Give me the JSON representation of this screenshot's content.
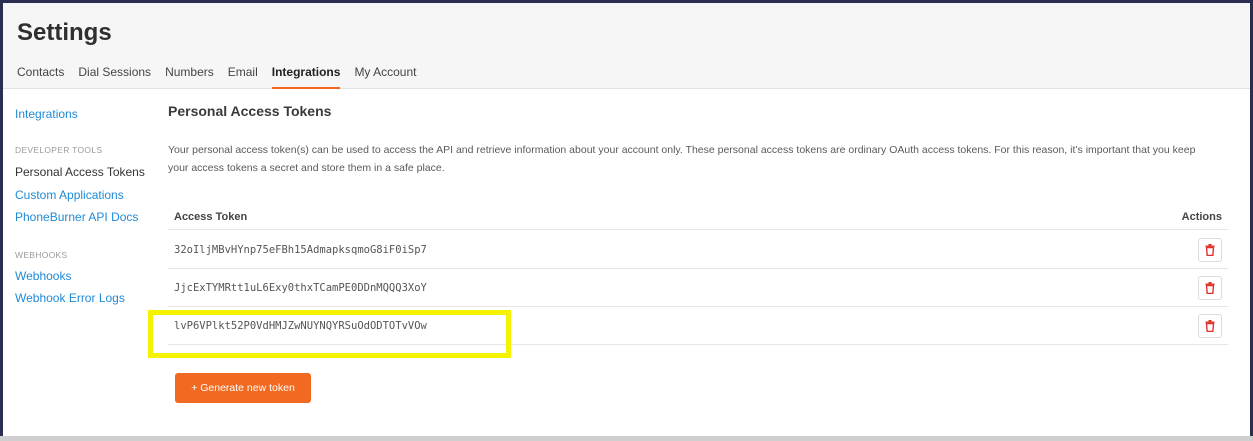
{
  "header": {
    "title": "Settings",
    "tabs": [
      {
        "label": "Contacts"
      },
      {
        "label": "Dial Sessions"
      },
      {
        "label": "Numbers"
      },
      {
        "label": "Email"
      },
      {
        "label": "Integrations"
      },
      {
        "label": "My Account"
      }
    ],
    "active_tab": "Integrations"
  },
  "sidebar": {
    "integrations_link": "Integrations",
    "developer_tools_heading": "DEVELOPER TOOLS",
    "personal_access_tokens": "Personal Access Tokens",
    "custom_applications": "Custom Applications",
    "api_docs": "PhoneBurner API Docs",
    "webhooks_heading": "WEBHOOKS",
    "webhooks": "Webhooks",
    "webhook_error_logs": "Webhook Error Logs"
  },
  "main": {
    "section_title": "Personal Access Tokens",
    "description": "Your personal access token(s) can be used to access the API and retrieve information about your account only. These personal access tokens are ordinary OAuth access tokens. For this reason, it’s important that you keep your access tokens a secret and store them in a safe place.",
    "table": {
      "col_token": "Access Token",
      "col_actions": "Actions",
      "rows": [
        {
          "token": "32oIljMBvHYnp75eFBh15AdmapksqmoG8iF0iSp7"
        },
        {
          "token": "JjcExTYMRtt1uL6Exy0thxTCamPE0DDnMQQQ3XoY"
        },
        {
          "token": "lvP6VPlkt52P0VdHMJZwNUYNQYRSuOdODTOTvVOw"
        }
      ]
    },
    "generate_button": "+ Generate new token"
  },
  "colors": {
    "accent": "#f26a21",
    "link": "#1f8ad6",
    "highlight": "#f5f200",
    "delete_icon": "#e0322b"
  }
}
